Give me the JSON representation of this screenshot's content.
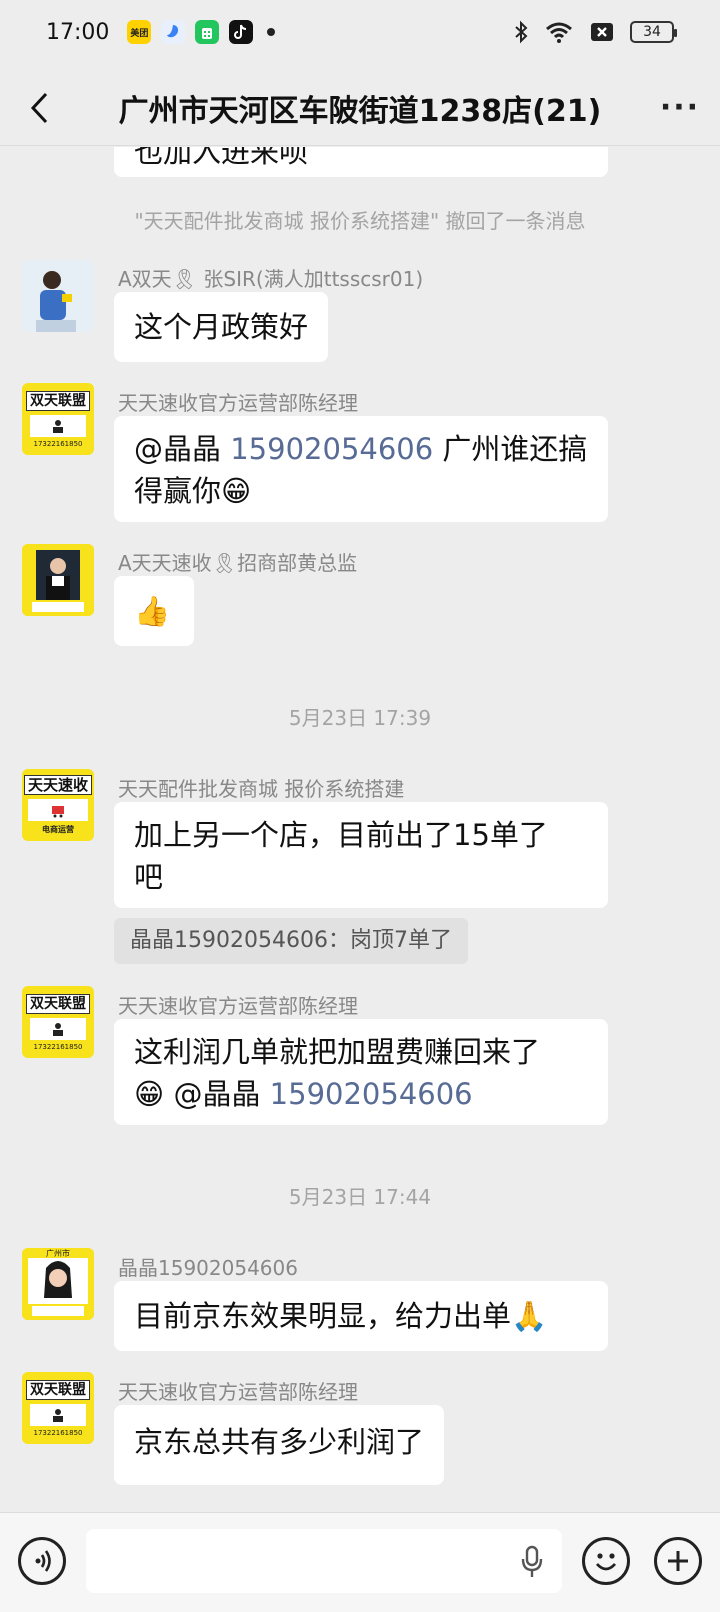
{
  "status_bar": {
    "time": "17:00",
    "app_icons": [
      {
        "name": "meituan-icon",
        "label": "美团",
        "color": "#ffd100"
      },
      {
        "name": "browser-icon",
        "label": "",
        "color": "#3b82f6"
      },
      {
        "name": "wechat-pay-icon",
        "label": "",
        "color": "#22c55e"
      },
      {
        "name": "tiktok-icon",
        "label": "",
        "color": "#111111"
      }
    ],
    "battery": "34"
  },
  "header": {
    "title": "广州市天河区车陂街道1238店(21)",
    "more": "···"
  },
  "chat": {
    "partial_message": "也加入进来呗",
    "recall_notice": "\"天天配件批发商城 报价系统搭建\" 撤回了一条消息",
    "msg1": {
      "sender": "A双天🎗 张SIR(满人加ttsscsr01)",
      "text": "这个月政策好"
    },
    "msg2": {
      "sender": "天天速收官方运营部陈经理",
      "mention": "@晶晶",
      "phone": "15902054606",
      "text_after": " 广州谁还搞",
      "text_line2": "得赢你😁"
    },
    "msg3": {
      "sender": "A天天速收🎗招商部黄总监",
      "text": "👍"
    },
    "time1": "5月23日 17:39",
    "msg4": {
      "sender": "天天配件批发商城 报价系统搭建",
      "line1": "加上另一个店，目前出了15单了",
      "line2": "吧"
    },
    "quote1": "晶晶15902054606：岗顶7单了",
    "msg5": {
      "sender": "天天速收官方运营部陈经理",
      "line1": "这利润几单就把加盟费赚回来了",
      "line2_prefix": "😁 @晶晶 ",
      "phone": "15902054606"
    },
    "time2": "5月23日 17:44",
    "msg6": {
      "sender": "晶晶15902054606",
      "text": "目前京东效果明显，给力出单🙏"
    },
    "msg7": {
      "sender": "天天速收官方运营部陈经理",
      "text": "京东总共有多少利润了"
    }
  },
  "avatars": {
    "shuangtian_big": "双天联盟",
    "shuangtian_phone": "17322161850",
    "tiantian_big": "天天速收",
    "tiantian_sub": "电商运营",
    "jingjing_top": "广州市"
  },
  "colors": {
    "link": "#576b95",
    "bg": "#ededed"
  }
}
